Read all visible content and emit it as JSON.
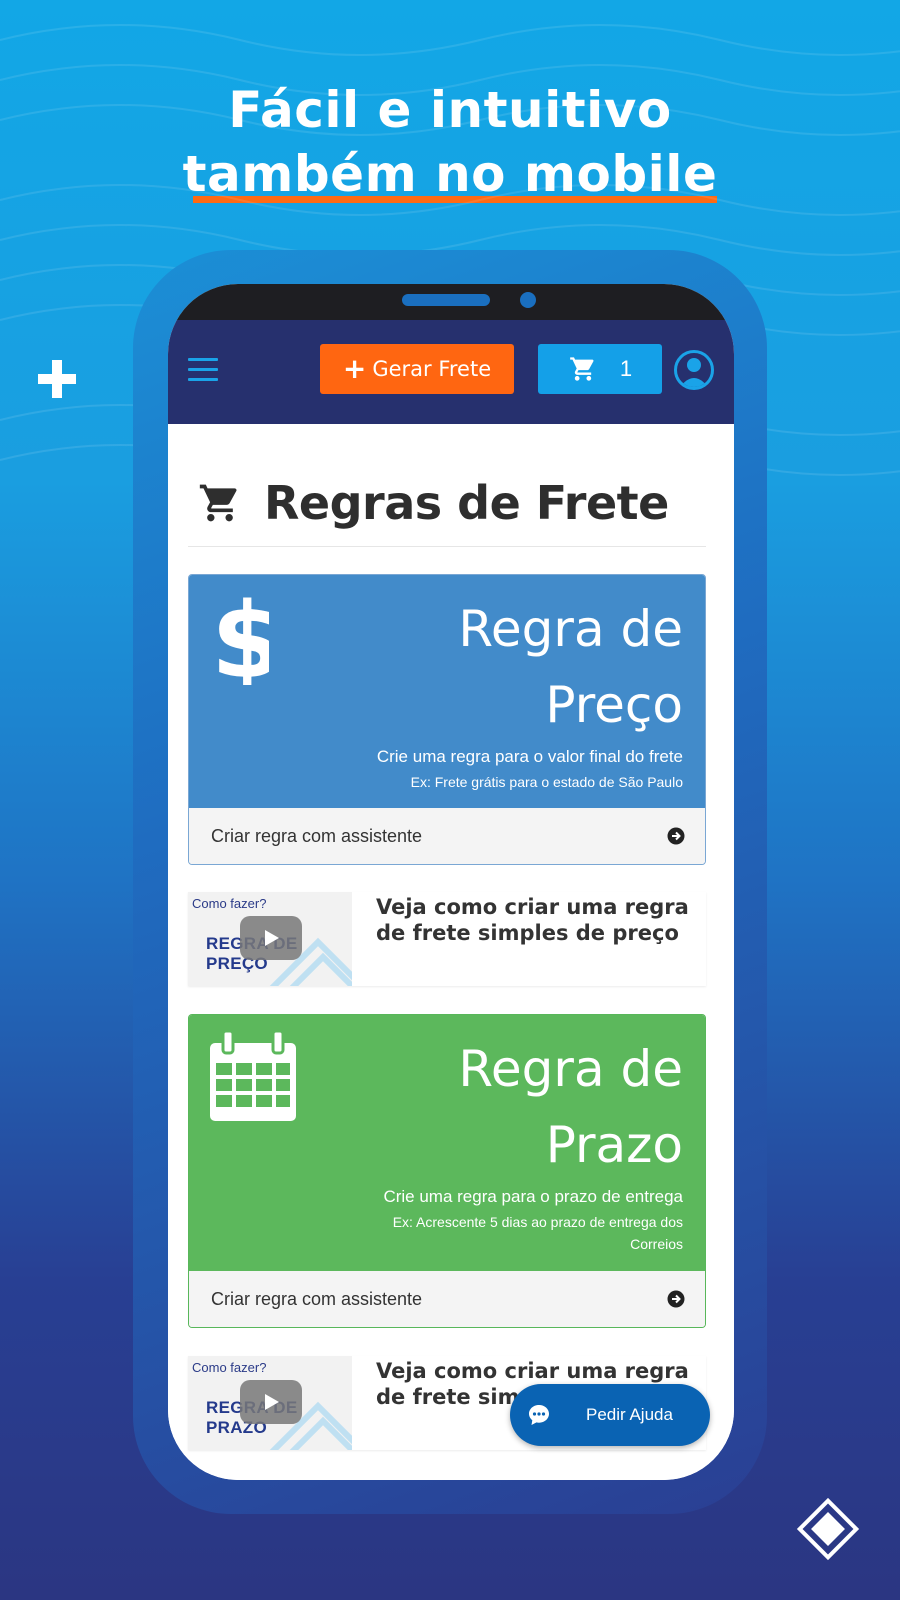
{
  "headline": {
    "line1": "Fácil e intuitivo",
    "line2": "também no mobile"
  },
  "appbar": {
    "generate_label": "Gerar Frete",
    "cart_count": "1"
  },
  "page": {
    "title": "Regras de Frete"
  },
  "cards": [
    {
      "title_line1": "Regra de",
      "title_line2": "Preço",
      "description": "Crie uma regra para o valor final do frete",
      "example_line1": "Ex: Frete grátis para o estado de São Paulo",
      "example_line2": "",
      "footer_label": "Criar regra com assistente",
      "color": "#428bca"
    },
    {
      "title_line1": "Regra de",
      "title_line2": "Prazo",
      "description": "Crie uma regra para o prazo de entrega",
      "example_line1": "Ex: Acrescente 5 dias ao prazo de entrega dos",
      "example_line2": "Correios",
      "footer_label": "Criar regra com assistente",
      "color": "#5cb85c"
    }
  ],
  "videos": [
    {
      "thumb_caption": "Como fazer?",
      "thumb_title": "REGRA DE PREÇO",
      "title": "Veja como criar uma regra de frete simples de preço"
    },
    {
      "thumb_caption": "Como fazer?",
      "thumb_title": "REGRA DE PRAZO",
      "title": "Veja como criar uma regra de frete simples de prazo"
    }
  ],
  "help": {
    "label": "Pedir Ajuda"
  },
  "colors": {
    "accent_orange": "#ff6611",
    "appbar": "#26306e",
    "cart_blue": "#14a0e8",
    "help_blue": "#0a63b3"
  }
}
